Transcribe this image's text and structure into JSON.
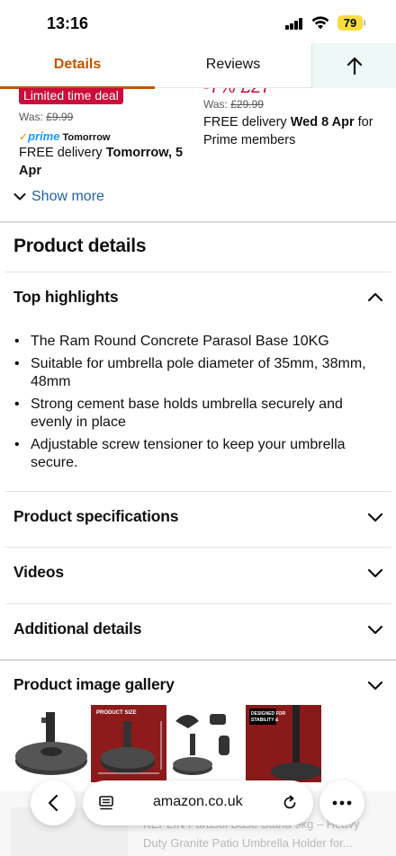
{
  "status_bar": {
    "time": "13:16",
    "battery": "79"
  },
  "tabs": {
    "details": "Details",
    "reviews": "Reviews"
  },
  "deal": {
    "badge": "Limited time deal",
    "partial_price": "-7% £27",
    "left": {
      "was_label": "Was:",
      "was_price": "£9.99",
      "prime_label": "prime",
      "prime_day": "Tomorrow",
      "delivery_prefix": "FREE delivery ",
      "delivery_date": "Tomorrow, 5 Apr"
    },
    "right": {
      "was_label": "Was:",
      "was_price": "£29.99",
      "delivery_prefix": "FREE delivery ",
      "delivery_date": "Wed 8 Apr",
      "delivery_suffix": " for Prime members"
    },
    "show_more": "Show more"
  },
  "product_details": {
    "title": "Product details",
    "top_highlights": {
      "heading": "Top highlights",
      "items": [
        "The Ram Round Concrete Parasol Base 10KG",
        "Suitable for umbrella pole diameter of 35mm, 38mm, 48mm",
        "Strong cement base holds umbrella securely and evenly in place",
        "Adjustable screw tensioner to keep your umbrella secure."
      ]
    },
    "sections": [
      "Product specifications",
      "Videos",
      "Additional details"
    ]
  },
  "gallery": {
    "heading": "Product image gallery",
    "thumb_labels": [
      "PRODUCT SIZE",
      "DESIGNED FOR STABILITY & VERSATILITY"
    ]
  },
  "browser": {
    "url": "amazon.co.uk",
    "behind_text": "KEPLIN Parasol Base Stand 9kg – Heavy Duty Granite Patio Umbrella Holder for..."
  },
  "colors": {
    "accent": "#c45500",
    "deal": "#cc0c39",
    "link": "#2162a1",
    "prime": "#1399ff"
  }
}
